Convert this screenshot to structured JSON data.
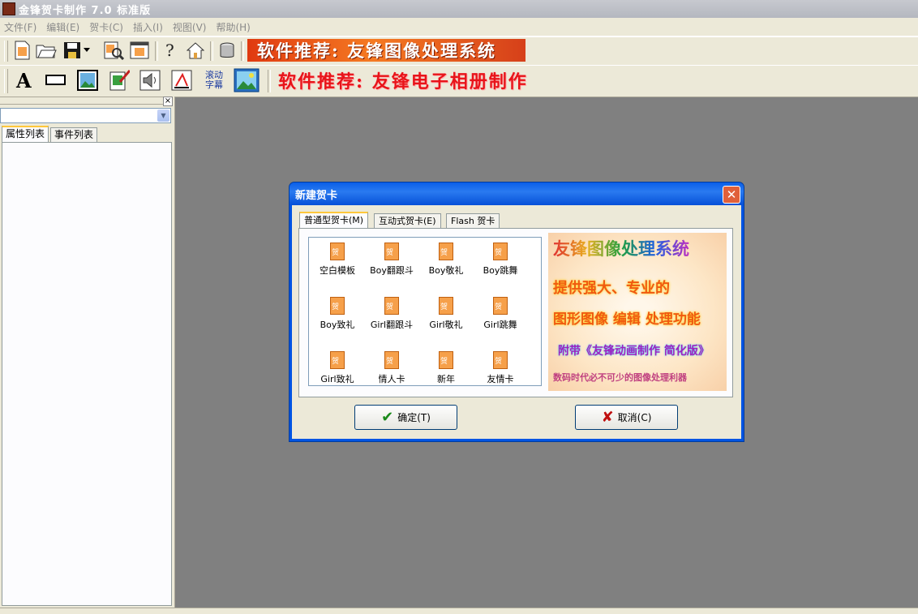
{
  "app": {
    "title": "金锋贺卡制作 7.0 标准版"
  },
  "menu": [
    {
      "label": "文件(F)"
    },
    {
      "label": "编辑(E)"
    },
    {
      "label": "贺卡(C)"
    },
    {
      "label": "插入(I)"
    },
    {
      "label": "视图(V)"
    },
    {
      "label": "帮助(H)"
    }
  ],
  "toolbar1": {
    "icons": [
      "new-card-icon",
      "open-folder-icon",
      "save-disk-icon",
      "save-dropdown-icon",
      "preview-magnifier-icon",
      "card-window-icon",
      "help-question-icon",
      "home-icon",
      "database-icon"
    ],
    "banner": "软件推荐: 友锋图像处理系统"
  },
  "toolbar2": {
    "icons": [
      "text-a-icon",
      "rectangle-icon",
      "image-icon",
      "edit-card-icon",
      "sound-icon",
      "effects-icon",
      "scroll-text-icon",
      "picture-frame-icon"
    ],
    "scroll_label_line1": "滚动",
    "scroll_label_line2": "字幕",
    "banner": "软件推荐: 友锋电子相册制作"
  },
  "left_panel": {
    "tabs": [
      {
        "label": "属性列表"
      },
      {
        "label": "事件列表"
      }
    ]
  },
  "dialog": {
    "title": "新建贺卡",
    "tabs": [
      {
        "label": "普通型贺卡(M)"
      },
      {
        "label": "互动式贺卡(E)"
      },
      {
        "label": "Flash 贺卡"
      }
    ],
    "templates": [
      {
        "label": "空白模板"
      },
      {
        "label": "Boy翻跟斗"
      },
      {
        "label": "Boy敬礼"
      },
      {
        "label": "Boy跳舞"
      },
      {
        "label": "Boy致礼"
      },
      {
        "label": "Girl翻跟斗"
      },
      {
        "label": "Girl敬礼"
      },
      {
        "label": "Girl跳舞"
      },
      {
        "label": "Girl致礼"
      },
      {
        "label": "情人卡"
      },
      {
        "label": "新年"
      },
      {
        "label": "友情卡"
      }
    ],
    "promo": {
      "line1": "友锋图像处理系统",
      "line2": "提供强大、专业的",
      "line3": "图形图像 编辑 处理功能",
      "line4": "附带《友锋动画制作 简化版》",
      "line5": "数码时代必不可少的图像处理利器"
    },
    "ok_label": "确定(T)",
    "cancel_label": "取消(C)"
  },
  "colors": {
    "accent": "#0054e3",
    "banner_bg": "#e8561c",
    "workspace": "#808080"
  }
}
